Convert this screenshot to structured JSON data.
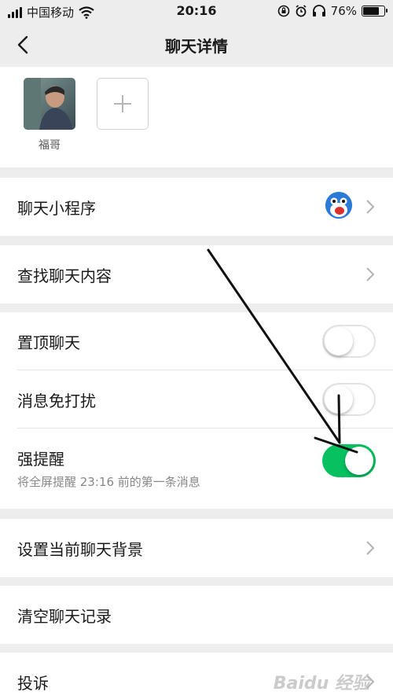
{
  "status": {
    "carrier": "中国移动",
    "time": "20:16",
    "battery": "76%",
    "battery_level": 0.76
  },
  "nav": {
    "title": "聊天详情"
  },
  "members": [
    {
      "name": "福哥"
    }
  ],
  "rows": {
    "mini_program": "聊天小程序",
    "search": "查找聊天内容",
    "pin": "置顶聊天",
    "mute": "消息免打扰",
    "strong_remind": "强提醒",
    "strong_remind_sub": "将全屏提醒 23:16 前的第一条消息",
    "background": "设置当前聊天背景",
    "clear": "清空聊天记录",
    "report": "投诉"
  },
  "toggles": {
    "pin": false,
    "mute": false,
    "strong_remind": true
  },
  "watermark": "Baidu 经验",
  "colors": {
    "accent": "#07c160",
    "background": "#ededed"
  }
}
